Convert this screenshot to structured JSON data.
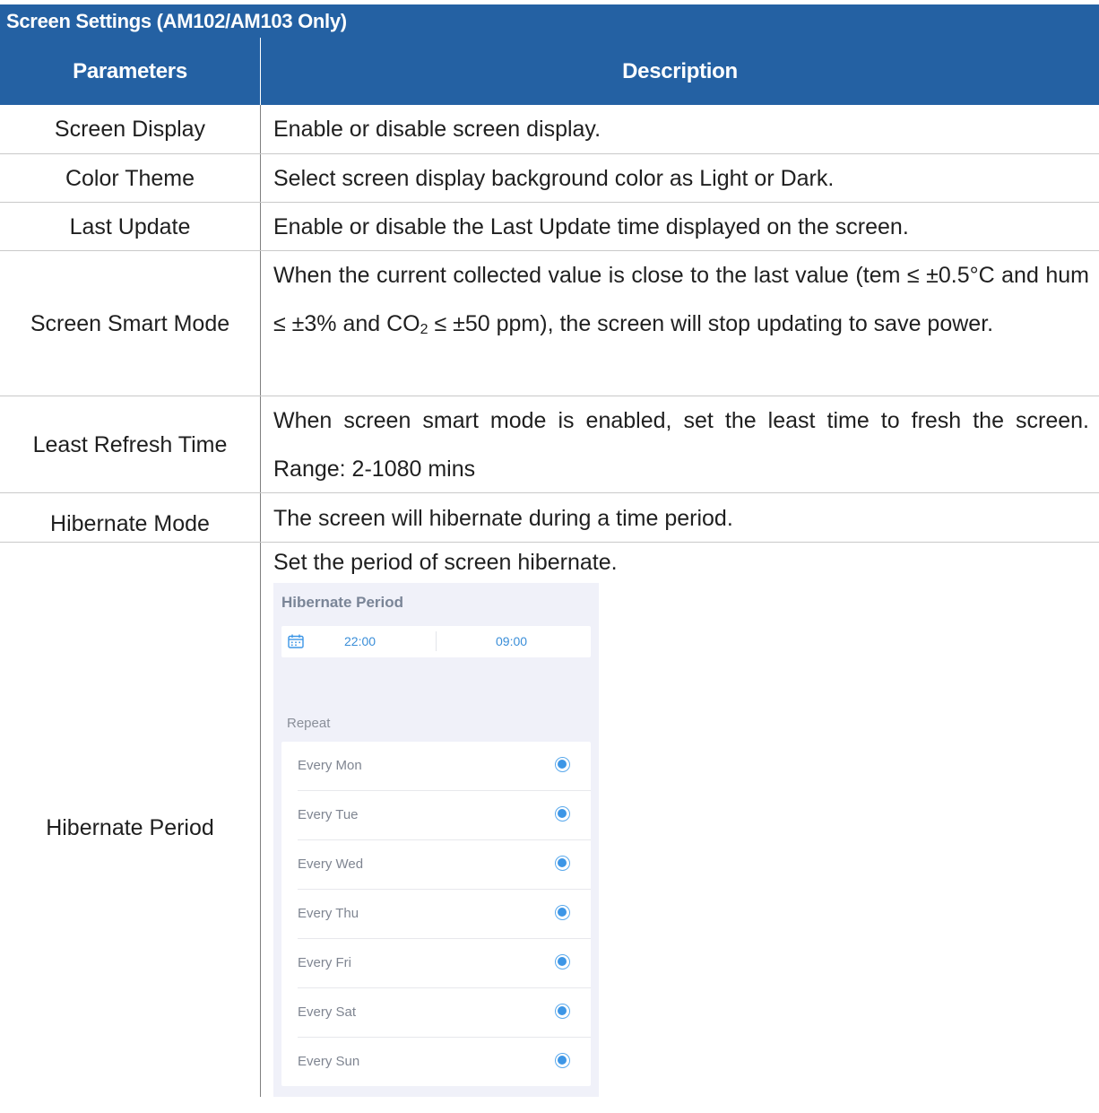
{
  "table": {
    "title": "Screen Settings (AM102/AM103 Only)",
    "header": {
      "parameters": "Parameters",
      "description": "Description"
    },
    "rows": [
      {
        "param": "Screen Display",
        "desc": "Enable or disable screen display."
      },
      {
        "param": "Color Theme",
        "desc": "Select screen display background color as Light or Dark."
      },
      {
        "param": "Last Update",
        "desc": "Enable or disable the Last Update time displayed on the screen."
      },
      {
        "param": "Screen Smart Mode",
        "desc_a": "When the current collected value is close to the last value (tem ≤ ±0.5°C and hum ≤ ±3% and CO",
        "desc_sub": "2",
        "desc_b": " ≤ ±50 ppm), the screen will stop updating to save power."
      },
      {
        "param": "Least Refresh Time",
        "desc": "When screen smart mode is enabled, set the least time to fresh the screen. Range: 2-1080 mins"
      },
      {
        "param": "Hibernate Mode",
        "desc": "The screen will hibernate during a time period."
      },
      {
        "param": "Hibernate Period",
        "desc": "Set the period of screen hibernate."
      }
    ]
  },
  "app": {
    "title": "Hibernate Period",
    "start_time": "22:00",
    "end_time": "09:00",
    "calendar_icon": "calendar-icon",
    "repeat_label": "Repeat",
    "days": [
      {
        "label": "Every Mon",
        "selected": true
      },
      {
        "label": "Every Tue",
        "selected": true
      },
      {
        "label": "Every Wed",
        "selected": true
      },
      {
        "label": "Every Thu",
        "selected": true
      },
      {
        "label": "Every Fri",
        "selected": true
      },
      {
        "label": "Every Sat",
        "selected": true
      },
      {
        "label": "Every Sun",
        "selected": true
      }
    ],
    "accent_color": "#3d96e6"
  },
  "colors": {
    "header_bg": "#2461a3",
    "header_text": "#ffffff"
  }
}
